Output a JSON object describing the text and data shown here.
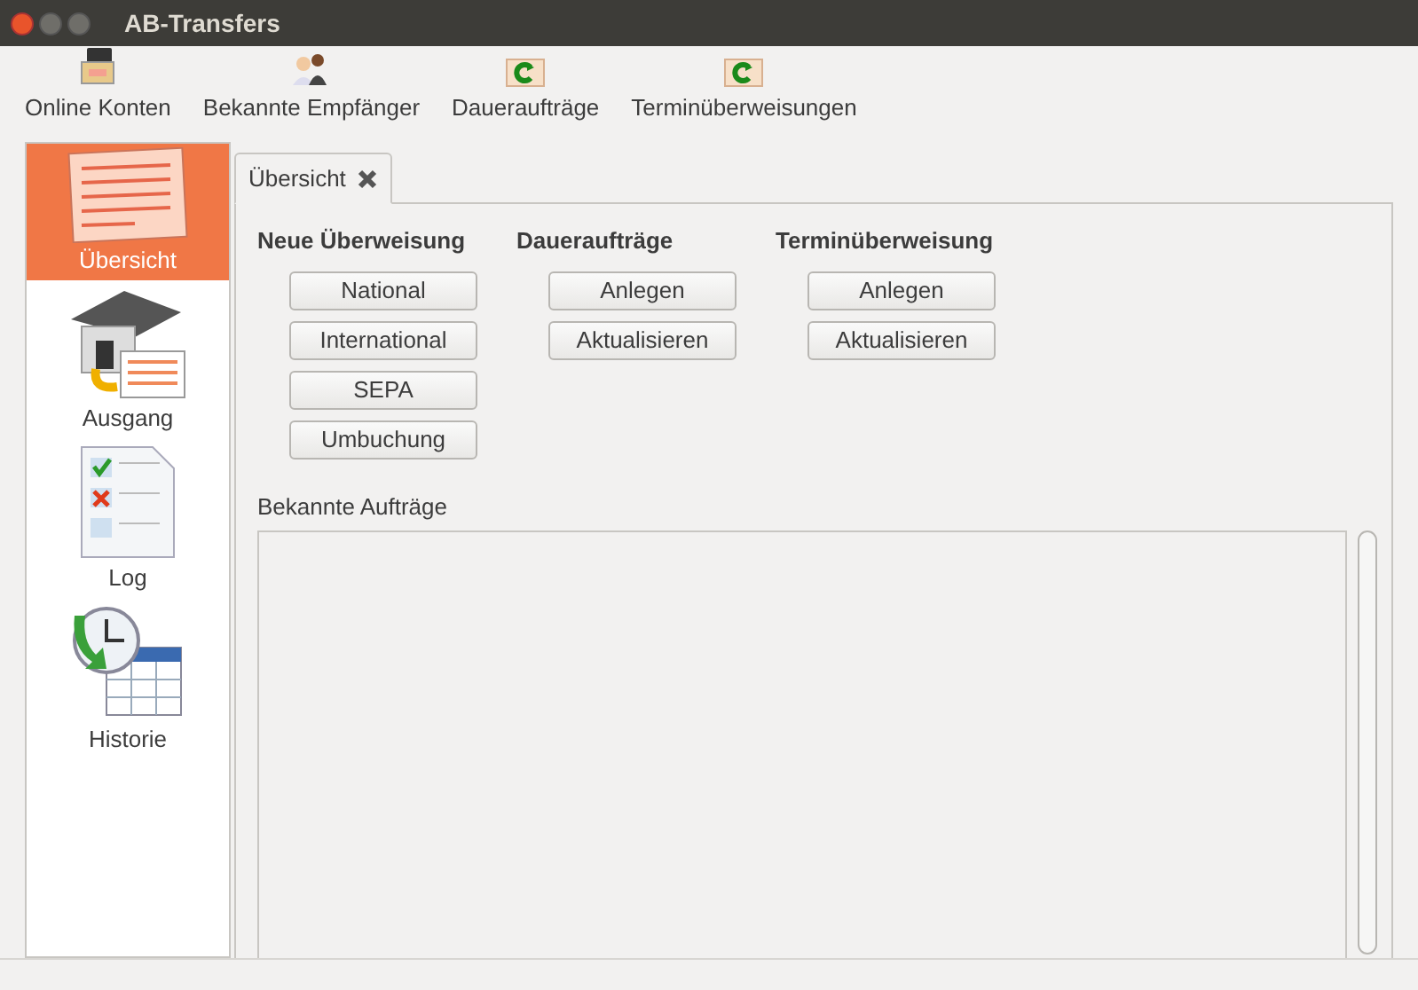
{
  "window": {
    "title": "AB-Transfers"
  },
  "toolbar": [
    {
      "label": "Online Konten",
      "kind": "accounts"
    },
    {
      "label": "Bekannte Empfänger",
      "kind": "people"
    },
    {
      "label": "Daueraufträge",
      "kind": "refresh"
    },
    {
      "label": "Terminüberweisungen",
      "kind": "refresh"
    }
  ],
  "sidebar": {
    "items": [
      {
        "label": "Übersicht",
        "kind": "form",
        "selected": true
      },
      {
        "label": "Ausgang",
        "kind": "bank",
        "selected": false
      },
      {
        "label": "Log",
        "kind": "log",
        "selected": false
      },
      {
        "label": "Historie",
        "kind": "history",
        "selected": false
      }
    ]
  },
  "tabs": [
    {
      "label": "Übersicht",
      "selected": true
    }
  ],
  "groups": [
    {
      "heading": "Neue Überweisung",
      "buttons": [
        "National",
        "International",
        "SEPA",
        "Umbuchung"
      ]
    },
    {
      "heading": "Daueraufträge",
      "buttons": [
        "Anlegen",
        "Aktualisieren"
      ]
    },
    {
      "heading": "Terminüberweisung",
      "buttons": [
        "Anlegen",
        "Aktualisieren"
      ]
    }
  ],
  "list": {
    "label": "Bekannte Aufträge"
  }
}
